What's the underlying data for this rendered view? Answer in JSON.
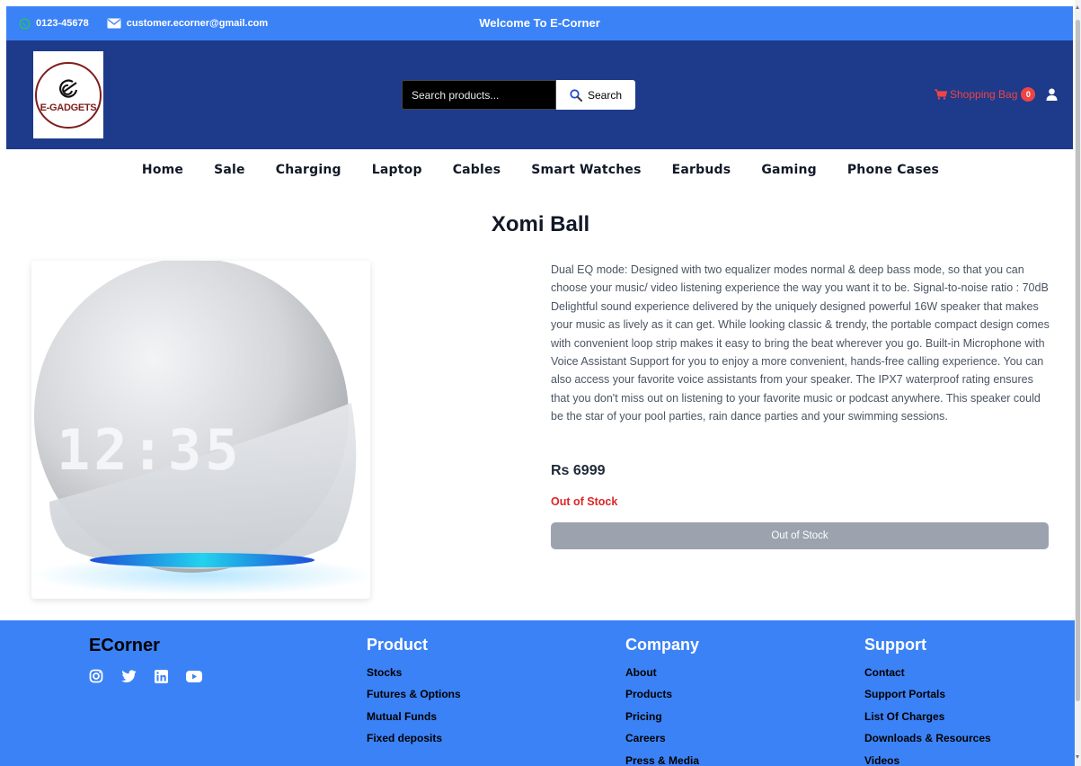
{
  "topbar": {
    "phone": "0123-45678",
    "email": "customer.ecorner@gmail.com",
    "welcome": "Welcome To E-Corner"
  },
  "header": {
    "logo_text": "E-GADGETS",
    "search_placeholder": "Search products...",
    "search_label": "Search",
    "bag_label": "Shopping Bag",
    "bag_count": "0",
    "accent": "#1e3a8a",
    "bag_color": "#ef4444"
  },
  "nav": {
    "items": [
      "Home",
      "Sale",
      "Charging",
      "Laptop",
      "Cables",
      "Smart Watches",
      "Earbuds",
      "Gaming",
      "Phone Cases"
    ]
  },
  "product": {
    "title": "Xomi Ball",
    "description": "Dual EQ mode: Designed with two equalizer modes normal & deep bass mode, so that you can choose your music/ video listening experience the way you want it to be. Signal-to-noise ratio : 70dB Delightful sound experience delivered by the uniquely designed powerful 16W speaker that makes your music as lively as it can get. While looking classic & trendy, the portable compact design comes with convenient loop strip makes it easy to bring the beat wherever you go. Built-in Microphone with Voice Assistant Support for you to enjoy a more convenient, hands-free calling experience. You can also access your favorite voice assistants from your speaker. The IPX7 waterproof rating ensures that you don't miss out on listening to your favorite music or podcast anywhere. This speaker could be the star of your pool parties, rain dance parties and your swimming sessions.",
    "price": "Rs 6999",
    "stock_status": "Out of Stock",
    "button_label": "Out of Stock",
    "clock_text": "12:35"
  },
  "footer": {
    "brand": "ECorner",
    "socials": [
      "instagram-icon",
      "twitter-icon",
      "linkedin-icon",
      "youtube-icon"
    ],
    "columns": [
      {
        "title": "Product",
        "links": [
          "Stocks",
          "Futures & Options",
          "Mutual Funds",
          "Fixed deposits"
        ]
      },
      {
        "title": "Company",
        "links": [
          "About",
          "Products",
          "Pricing",
          "Careers",
          "Press & Media"
        ]
      },
      {
        "title": "Support",
        "links": [
          "Contact",
          "Support Portals",
          "List Of Charges",
          "Downloads & Resources",
          "Videos"
        ]
      }
    ],
    "background": "#3b82f6"
  }
}
